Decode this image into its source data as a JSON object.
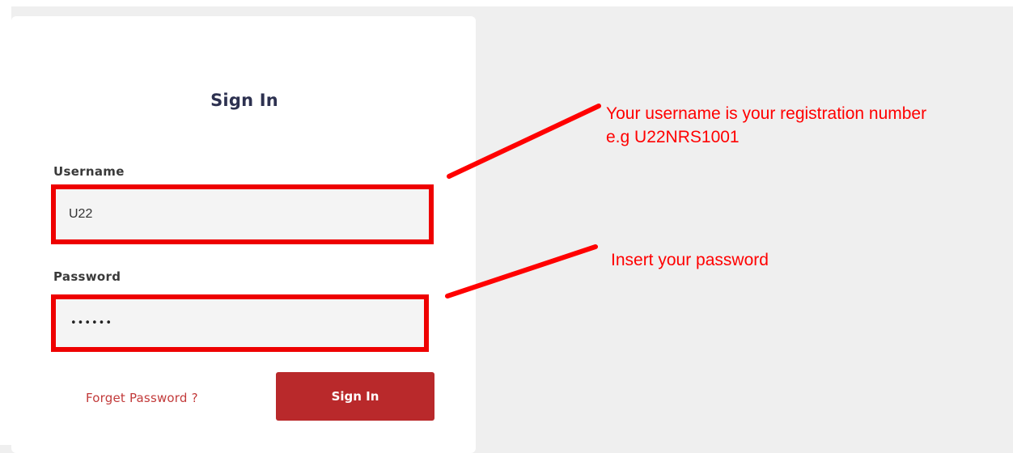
{
  "form": {
    "title": "Sign In",
    "username": {
      "label": "Username",
      "value": "U22"
    },
    "password": {
      "label": "Password",
      "masked_value": "••••••"
    },
    "forgot_link": "Forget Password ?",
    "submit_label": "Sign In"
  },
  "annotations": {
    "username_hint_line1": "Your username is your registration number",
    "username_hint_line2": "e.g U22NRS1001",
    "password_hint": "Insert your password"
  },
  "colors": {
    "annotation": "#ff0000",
    "button": "#b9292b",
    "link": "#c23a3a",
    "title": "#2d3150"
  }
}
